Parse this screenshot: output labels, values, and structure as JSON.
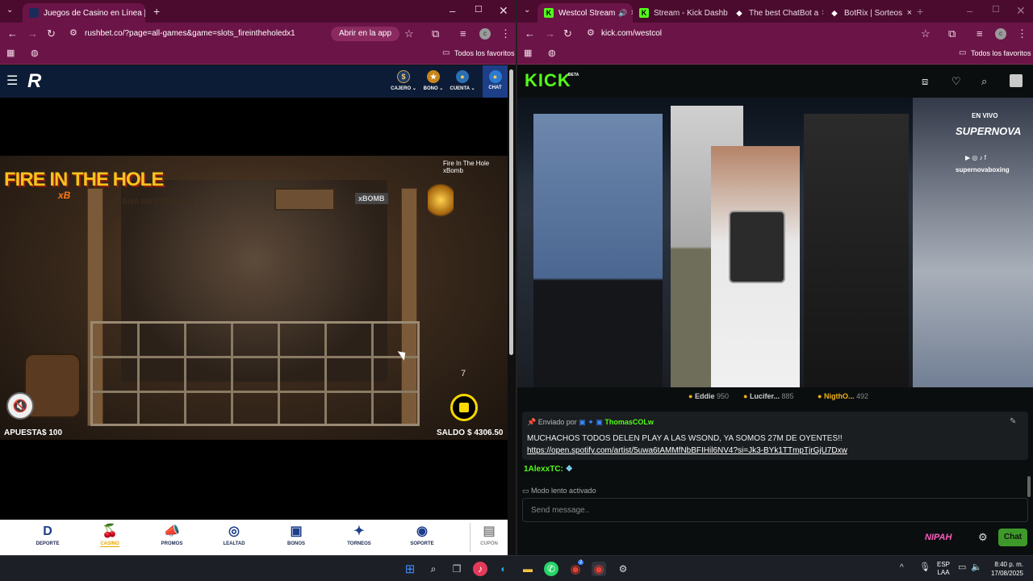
{
  "left_browser": {
    "tabs": [
      {
        "label": "Juegos de Casino en Línea | Ca",
        "close": "×"
      }
    ],
    "new_tab": "+",
    "url": "rushbet.co/?page=all-games&game=slots_fireintheholedx1",
    "open_in_app": "Abrir en la app",
    "bookmarks_folder": "Todos los favoritos",
    "avatar_letter": "c"
  },
  "rushbet": {
    "logo": "R",
    "header": [
      {
        "label": "CAJERO ⌄",
        "icon": "$"
      },
      {
        "label": "BONO ⌄",
        "icon": "★"
      },
      {
        "label": "CUENTA ⌄",
        "icon": "●"
      },
      {
        "label": "CHAT",
        "icon": "●"
      }
    ],
    "game": {
      "logo_line1": "FIRE IN THE HOLE",
      "logo_line2": "xB",
      "title_tag": "Fire In The Hole xBomb",
      "sign": "GANA HASTA 60.000 X",
      "brand_plate": "xBOMB",
      "apuesta_label": "APUESTA",
      "apuesta_value": "$ 100",
      "saldo_label": "SALDO",
      "saldo_value": "$ 4306.50",
      "counter": "7"
    },
    "nav": [
      {
        "label": "DEPORTE",
        "icon": "D"
      },
      {
        "label": "CASINO",
        "icon": "🍒"
      },
      {
        "label": "PROMOS",
        "icon": "📣"
      },
      {
        "label": "LEALTAD",
        "icon": "◎"
      },
      {
        "label": "BONOS",
        "icon": "▣"
      },
      {
        "label": "TORNEOS",
        "icon": "✦"
      },
      {
        "label": "SOPORTE",
        "icon": "◉"
      },
      {
        "label": "CUPÓN",
        "icon": "▤"
      }
    ]
  },
  "right_browser": {
    "tabs": [
      {
        "label": "Westcol Stream",
        "close": "×"
      },
      {
        "label": "Stream - Kick Dashb",
        "close": "×"
      },
      {
        "label": "The best ChatBot a",
        "close": "×"
      },
      {
        "label": "BotRix | Sorteos",
        "close": "×"
      }
    ],
    "new_tab": "+",
    "url": "kick.com/westcol",
    "bookmarks_folder": "Todos los favoritos",
    "avatar_letter": "c"
  },
  "kick": {
    "logo": "KICK",
    "logo_sup": "BETA",
    "overlay": {
      "live": "EN VIVO",
      "brand": "SUPERNOVA",
      "handle": "supernovaboxing"
    },
    "leaders": [
      {
        "name": "Eddie",
        "points": "950"
      },
      {
        "name": "Lucifer...",
        "points": "885"
      },
      {
        "name": "NigthO...",
        "points": "492"
      }
    ],
    "pinned": {
      "sent_by": "Enviado por",
      "user": "ThomasCOLw",
      "message": "MUCHACHOS TODOS DELEN PLAY A LAS WSOND, YA SOMOS 27M DE OYENTES!!",
      "link": "https://open.spotify.com/artist/5uwa6tAMMfNbBFIHil6NV4?si=Jk3-BYk1TTmpTjrGjU7Dxw"
    },
    "chat_message": {
      "user": "1AlexxTC:"
    },
    "slow_mode": "Modo lento activado",
    "input_placeholder": "Send message..",
    "nipah": "NIPAH",
    "chat_button": "Chat"
  },
  "taskbar": {
    "lang1": "ESP",
    "lang2": "LAA",
    "time": "8:40 p. m.",
    "date": "17/08/2025",
    "chrome_badge": "2"
  },
  "colors": {
    "chrome_tab_bg": "#4a0b2e",
    "chrome_toolbar": "#6b1447",
    "kick_green": "#53fc18",
    "rushbet_navy": "#0d1c36",
    "spin_yellow": "#f7d800"
  }
}
